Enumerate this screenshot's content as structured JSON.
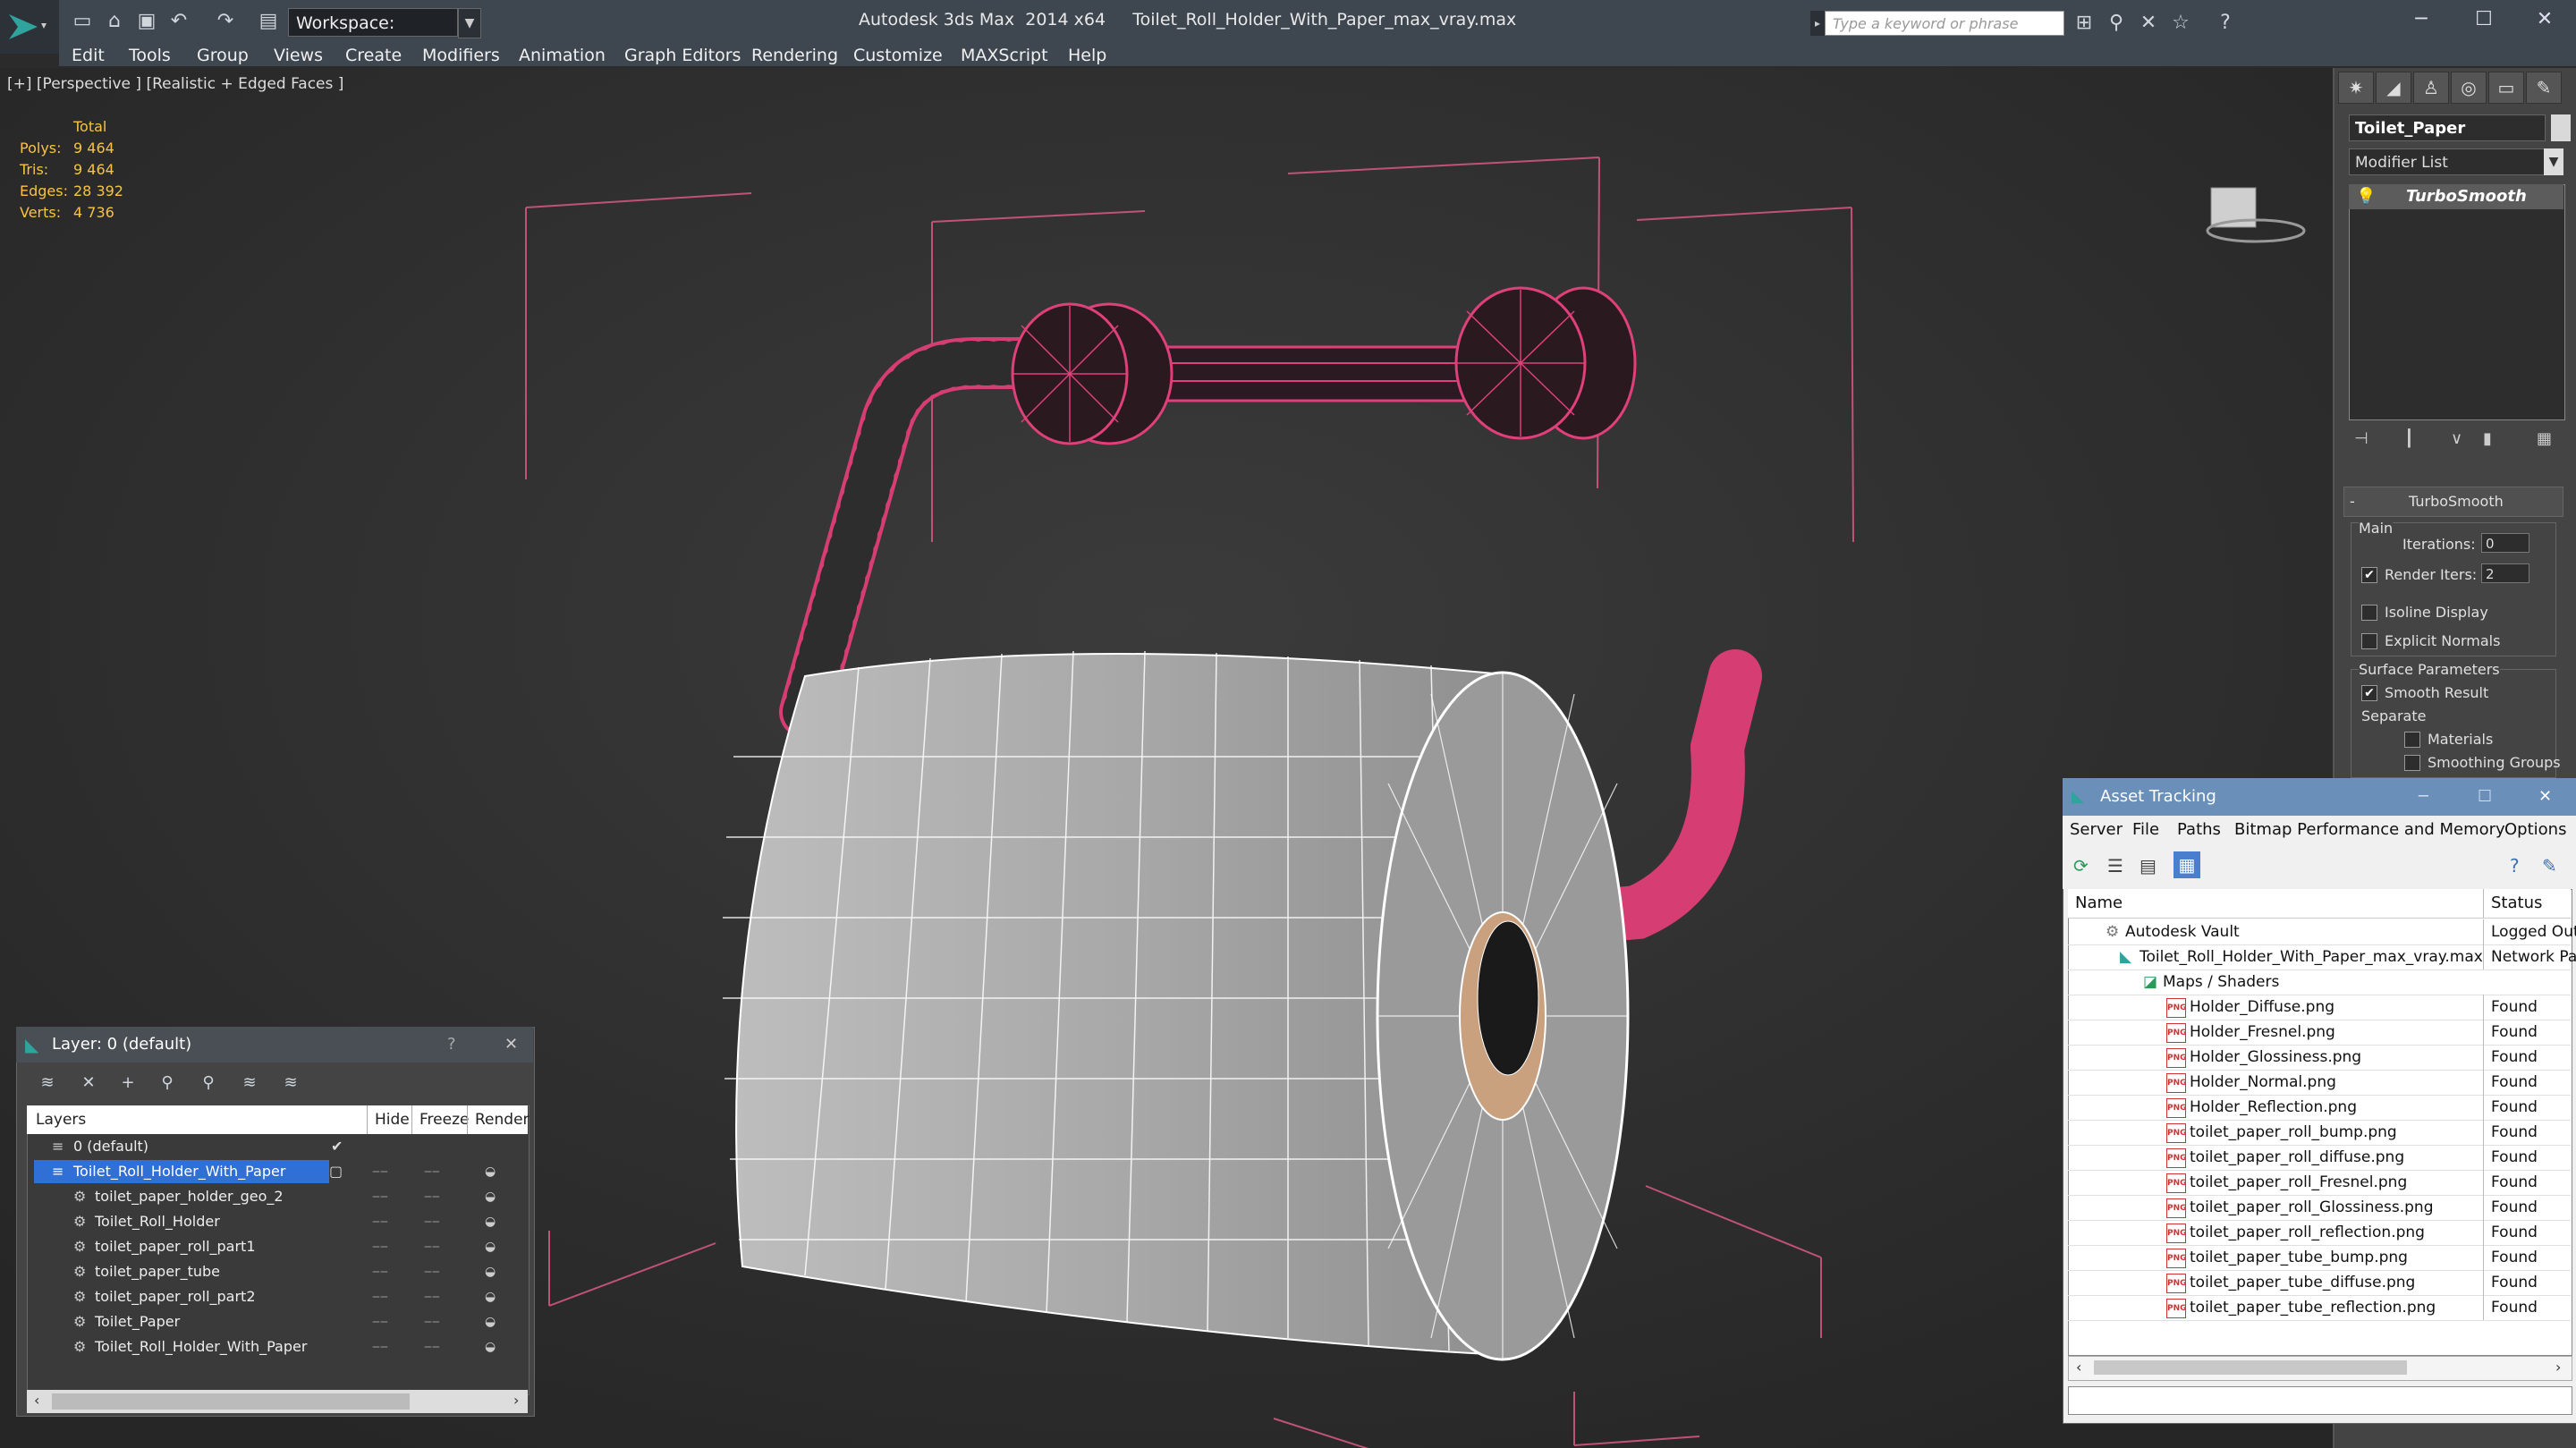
{
  "app": {
    "title": "Autodesk 3ds Max  2014 x64     Toilet_Roll_Holder_With_Paper_max_vray.max",
    "workspace_label": "Workspace: Default",
    "search_placeholder": "Type a keyword or phrase"
  },
  "menu": [
    "Edit",
    "Tools",
    "Group",
    "Views",
    "Create",
    "Modifiers",
    "Animation",
    "Graph Editors",
    "Rendering",
    "Customize",
    "MAXScript",
    "Help"
  ],
  "viewport": {
    "label": "[+] [Perspective ] [Realistic + Edged Faces ]",
    "stats_header": "Total",
    "stats": [
      {
        "label": "Polys:",
        "value": "9 464"
      },
      {
        "label": "Tris:",
        "value": "9 464"
      },
      {
        "label": "Edges:",
        "value": "28 392"
      },
      {
        "label": "Verts:",
        "value": "4 736"
      }
    ]
  },
  "command_panel": {
    "object_name": "Toilet_Paper",
    "modifier_list_label": "Modifier List",
    "modifier_stack": [
      "TurboSmooth"
    ],
    "rollout_title": "TurboSmooth",
    "main_group": "Main",
    "iterations_label": "Iterations:",
    "iterations_value": "0",
    "render_iters_label": "Render Iters:",
    "render_iters_value": "2",
    "render_iters_checked": true,
    "isoline_label": "Isoline Display",
    "explicit_normals_label": "Explicit Normals",
    "surface_group": "Surface Parameters",
    "smooth_result_label": "Smooth Result",
    "separate_label": "Separate",
    "materials_label": "Materials",
    "smoothing_groups_label": "Smoothing Groups"
  },
  "layer_panel": {
    "title": "Layer: 0 (default)",
    "help": "?",
    "close": "✕",
    "columns": [
      "Layers",
      "Hide",
      "Freeze",
      "Render"
    ],
    "rows": [
      {
        "name": "0 (default)",
        "level": 0,
        "active": true
      },
      {
        "name": "Toilet_Roll_Holder_With_Paper",
        "level": 0,
        "selected": true
      },
      {
        "name": "toilet_paper_holder_geo_2",
        "level": 1
      },
      {
        "name": "Toilet_Roll_Holder",
        "level": 1
      },
      {
        "name": "toilet_paper_roll_part1",
        "level": 1
      },
      {
        "name": "toilet_paper_tube",
        "level": 1
      },
      {
        "name": "toilet_paper_roll_part2",
        "level": 1
      },
      {
        "name": "Toilet_Paper",
        "level": 1
      },
      {
        "name": "Toilet_Roll_Holder_With_Paper",
        "level": 1
      }
    ]
  },
  "asset_tracking": {
    "title": "Asset Tracking",
    "menu": [
      "Server",
      "File",
      "Paths",
      "Bitmap Performance and Memory",
      "Options"
    ],
    "columns": [
      "Name",
      "Status"
    ],
    "rows": [
      {
        "name": "Autodesk Vault",
        "status": "Logged Out",
        "level": 0,
        "icon": "vault"
      },
      {
        "name": "Toilet_Roll_Holder_With_Paper_max_vray.max",
        "status": "Network Pat",
        "level": 1,
        "icon": "max"
      },
      {
        "name": "Maps / Shaders",
        "status": "",
        "level": 2,
        "icon": "folder"
      },
      {
        "name": "Holder_Diffuse.png",
        "status": "Found",
        "level": 3,
        "icon": "png"
      },
      {
        "name": "Holder_Fresnel.png",
        "status": "Found",
        "level": 3,
        "icon": "png"
      },
      {
        "name": "Holder_Glossiness.png",
        "status": "Found",
        "level": 3,
        "icon": "png"
      },
      {
        "name": "Holder_Normal.png",
        "status": "Found",
        "level": 3,
        "icon": "png"
      },
      {
        "name": "Holder_Reflection.png",
        "status": "Found",
        "level": 3,
        "icon": "png"
      },
      {
        "name": "toilet_paper_roll_bump.png",
        "status": "Found",
        "level": 3,
        "icon": "png"
      },
      {
        "name": "toilet_paper_roll_diffuse.png",
        "status": "Found",
        "level": 3,
        "icon": "png"
      },
      {
        "name": "toilet_paper_roll_Fresnel.png",
        "status": "Found",
        "level": 3,
        "icon": "png"
      },
      {
        "name": "toilet_paper_roll_Glossiness.png",
        "status": "Found",
        "level": 3,
        "icon": "png"
      },
      {
        "name": "toilet_paper_roll_reflection.png",
        "status": "Found",
        "level": 3,
        "icon": "png"
      },
      {
        "name": "toilet_paper_tube_bump.png",
        "status": "Found",
        "level": 3,
        "icon": "png"
      },
      {
        "name": "toilet_paper_tube_diffuse.png",
        "status": "Found",
        "level": 3,
        "icon": "png"
      },
      {
        "name": "toilet_paper_tube_reflection.png",
        "status": "Found",
        "level": 3,
        "icon": "png"
      }
    ]
  },
  "colors": {
    "wireframe_pink": "#e0407a",
    "stats_yellow": "#f6c344",
    "selection_blue": "#2f6fd6",
    "asset_title_blue": "#6a8fb8"
  }
}
